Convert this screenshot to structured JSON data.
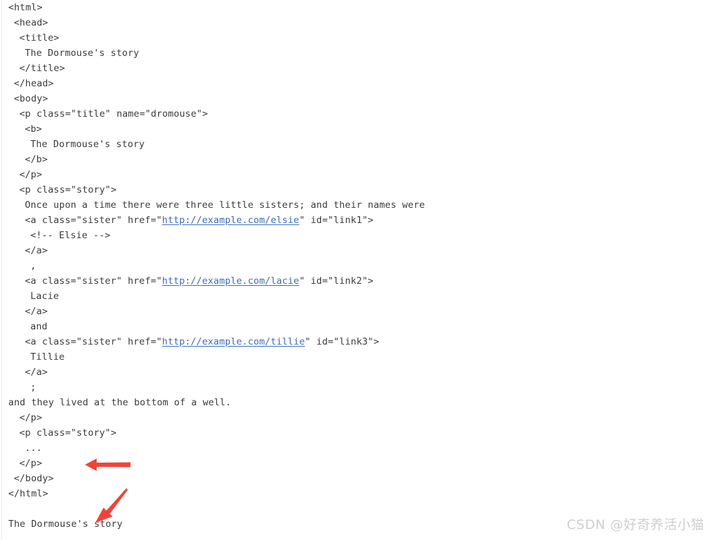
{
  "page": {
    "background_color": "#ffffff",
    "text_color": "#3b3b3b",
    "link_color": "#3d6cb9",
    "annotation_color": "#f04438",
    "watermark_color": "#cfcfcf"
  },
  "code": {
    "language": "html",
    "lines": [
      {
        "indent": 0,
        "text": "<html>"
      },
      {
        "indent": 1,
        "text": "<head>"
      },
      {
        "indent": 2,
        "text": "<title>"
      },
      {
        "indent": 3,
        "text": "The Dormouse's story"
      },
      {
        "indent": 2,
        "text": "</title>"
      },
      {
        "indent": 1,
        "text": "</head>"
      },
      {
        "indent": 1,
        "text": "<body>"
      },
      {
        "indent": 2,
        "text": "<p class=\"title\" name=\"dromouse\">"
      },
      {
        "indent": 3,
        "text": "<b>"
      },
      {
        "indent": 4,
        "text": "The Dormouse's story"
      },
      {
        "indent": 3,
        "text": "</b>"
      },
      {
        "indent": 2,
        "text": "</p>"
      },
      {
        "indent": 2,
        "text": "<p class=\"story\">"
      },
      {
        "indent": 3,
        "text": "Once upon a time there were three little sisters; and their names were"
      },
      {
        "indent": 3,
        "text": "<a class=\"sister\" href=\"",
        "link": "http://example.com/elsie",
        "text_after": "\" id=\"link1\">"
      },
      {
        "indent": 4,
        "text": "<!-- Elsie -->"
      },
      {
        "indent": 3,
        "text": "</a>"
      },
      {
        "indent": 4,
        "text": ","
      },
      {
        "indent": 3,
        "text": "<a class=\"sister\" href=\"",
        "link": "http://example.com/lacie",
        "text_after": "\" id=\"link2\">"
      },
      {
        "indent": 4,
        "text": "Lacie"
      },
      {
        "indent": 3,
        "text": "</a>"
      },
      {
        "indent": 4,
        "text": "and"
      },
      {
        "indent": 3,
        "text": "<a class=\"sister\" href=\"",
        "link": "http://example.com/tillie",
        "text_after": "\" id=\"link3\">"
      },
      {
        "indent": 4,
        "text": "Tillie"
      },
      {
        "indent": 3,
        "text": "</a>"
      },
      {
        "indent": 4,
        "text": ";"
      },
      {
        "indent": 0,
        "text": "and they lived at the bottom of a well."
      },
      {
        "indent": 2,
        "text": "</p>"
      },
      {
        "indent": 2,
        "text": "<p class=\"story\">"
      },
      {
        "indent": 3,
        "text": "..."
      },
      {
        "indent": 2,
        "text": "</p>"
      },
      {
        "indent": 1,
        "text": "</body>"
      },
      {
        "indent": 0,
        "text": "</html>"
      },
      {
        "indent": 0,
        "text": ""
      },
      {
        "indent": 0,
        "text": "The Dormouse's story"
      }
    ]
  },
  "annotations": [
    {
      "name": "arrow-horizontal",
      "direction": "left",
      "color": "#f04438"
    },
    {
      "name": "arrow-diagonal",
      "direction": "down-left",
      "color": "#f04438"
    }
  ],
  "watermark": {
    "text": "CSDN @好奇养活小猫"
  }
}
